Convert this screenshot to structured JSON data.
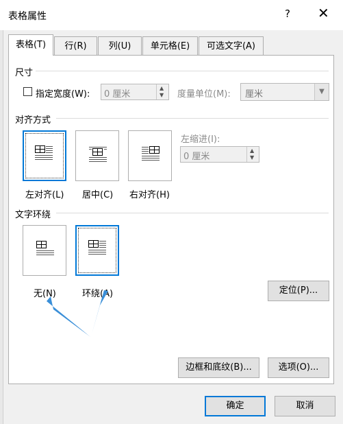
{
  "window": {
    "title": "表格属性",
    "help_glyph": "?",
    "close_glyph": "✕"
  },
  "tabs": [
    {
      "label": "表格(T)",
      "active": true
    },
    {
      "label": "行(R)",
      "active": false
    },
    {
      "label": "列(U)",
      "active": false
    },
    {
      "label": "单元格(E)",
      "active": false
    },
    {
      "label": "可选文字(A)",
      "active": false
    }
  ],
  "size": {
    "group_label": "尺寸",
    "preferred_width_label": "指定宽度(W):",
    "preferred_width_checked": false,
    "width_value": "0 厘米",
    "measure_in_label": "度量单位(M):",
    "measure_in_value": "厘米"
  },
  "alignment": {
    "group_label": "对齐方式",
    "options": [
      {
        "label": "左对齐(L)",
        "selected": true
      },
      {
        "label": "居中(C)",
        "selected": false
      },
      {
        "label": "右对齐(H)",
        "selected": false
      }
    ],
    "indent_label": "左缩进(I):",
    "indent_value": "0 厘米"
  },
  "wrapping": {
    "group_label": "文字环绕",
    "options": [
      {
        "label": "无(N)",
        "selected": false
      },
      {
        "label": "环绕(A)",
        "selected": true
      }
    ],
    "positioning_label": "定位(P)..."
  },
  "buttons": {
    "borders_label": "边框和底纹(B)...",
    "options_label": "选项(O)...",
    "ok_label": "确定",
    "cancel_label": "取消"
  },
  "colors": {
    "accent": "#0078d7",
    "annotation_arrow": "#3a8fd8"
  }
}
